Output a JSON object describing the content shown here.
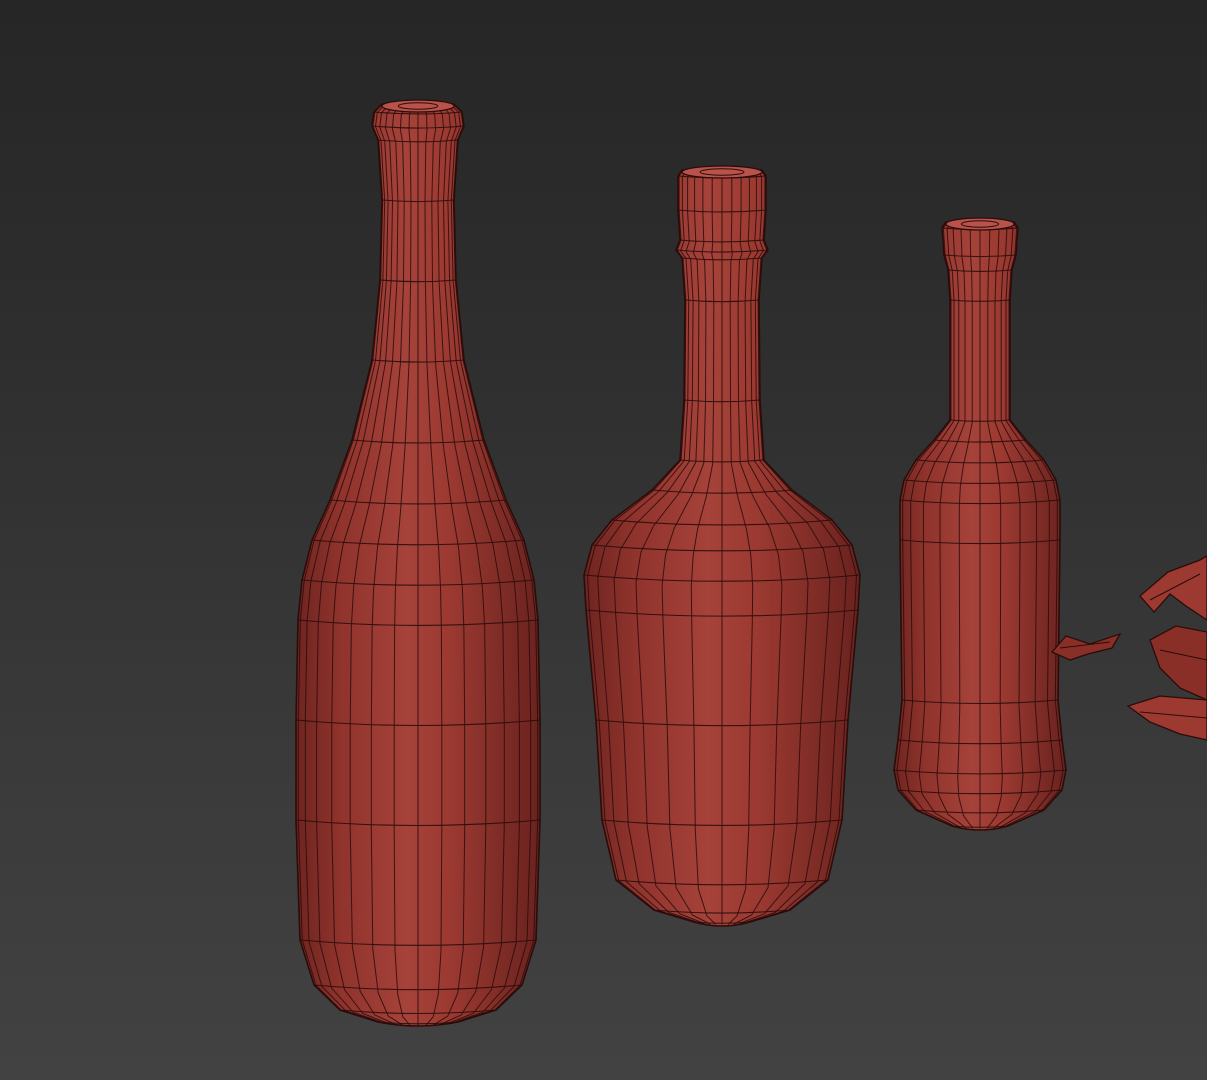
{
  "viewport": {
    "background_top": "#262626",
    "background_bottom": "#424242"
  },
  "scene": {
    "material_color": "#9c3a32",
    "material_shadow": "#6e2420",
    "material_highlight": "#b8524a",
    "wire_color": "#2a0c0a",
    "objects": [
      {
        "name": "wine-bottle",
        "icon": "bottle-icon"
      },
      {
        "name": "liquor-bottle",
        "icon": "bottle-icon"
      },
      {
        "name": "small-bottle",
        "icon": "bottle-icon"
      },
      {
        "name": "broken-glass-shards",
        "icon": "shard-icon"
      }
    ]
  }
}
